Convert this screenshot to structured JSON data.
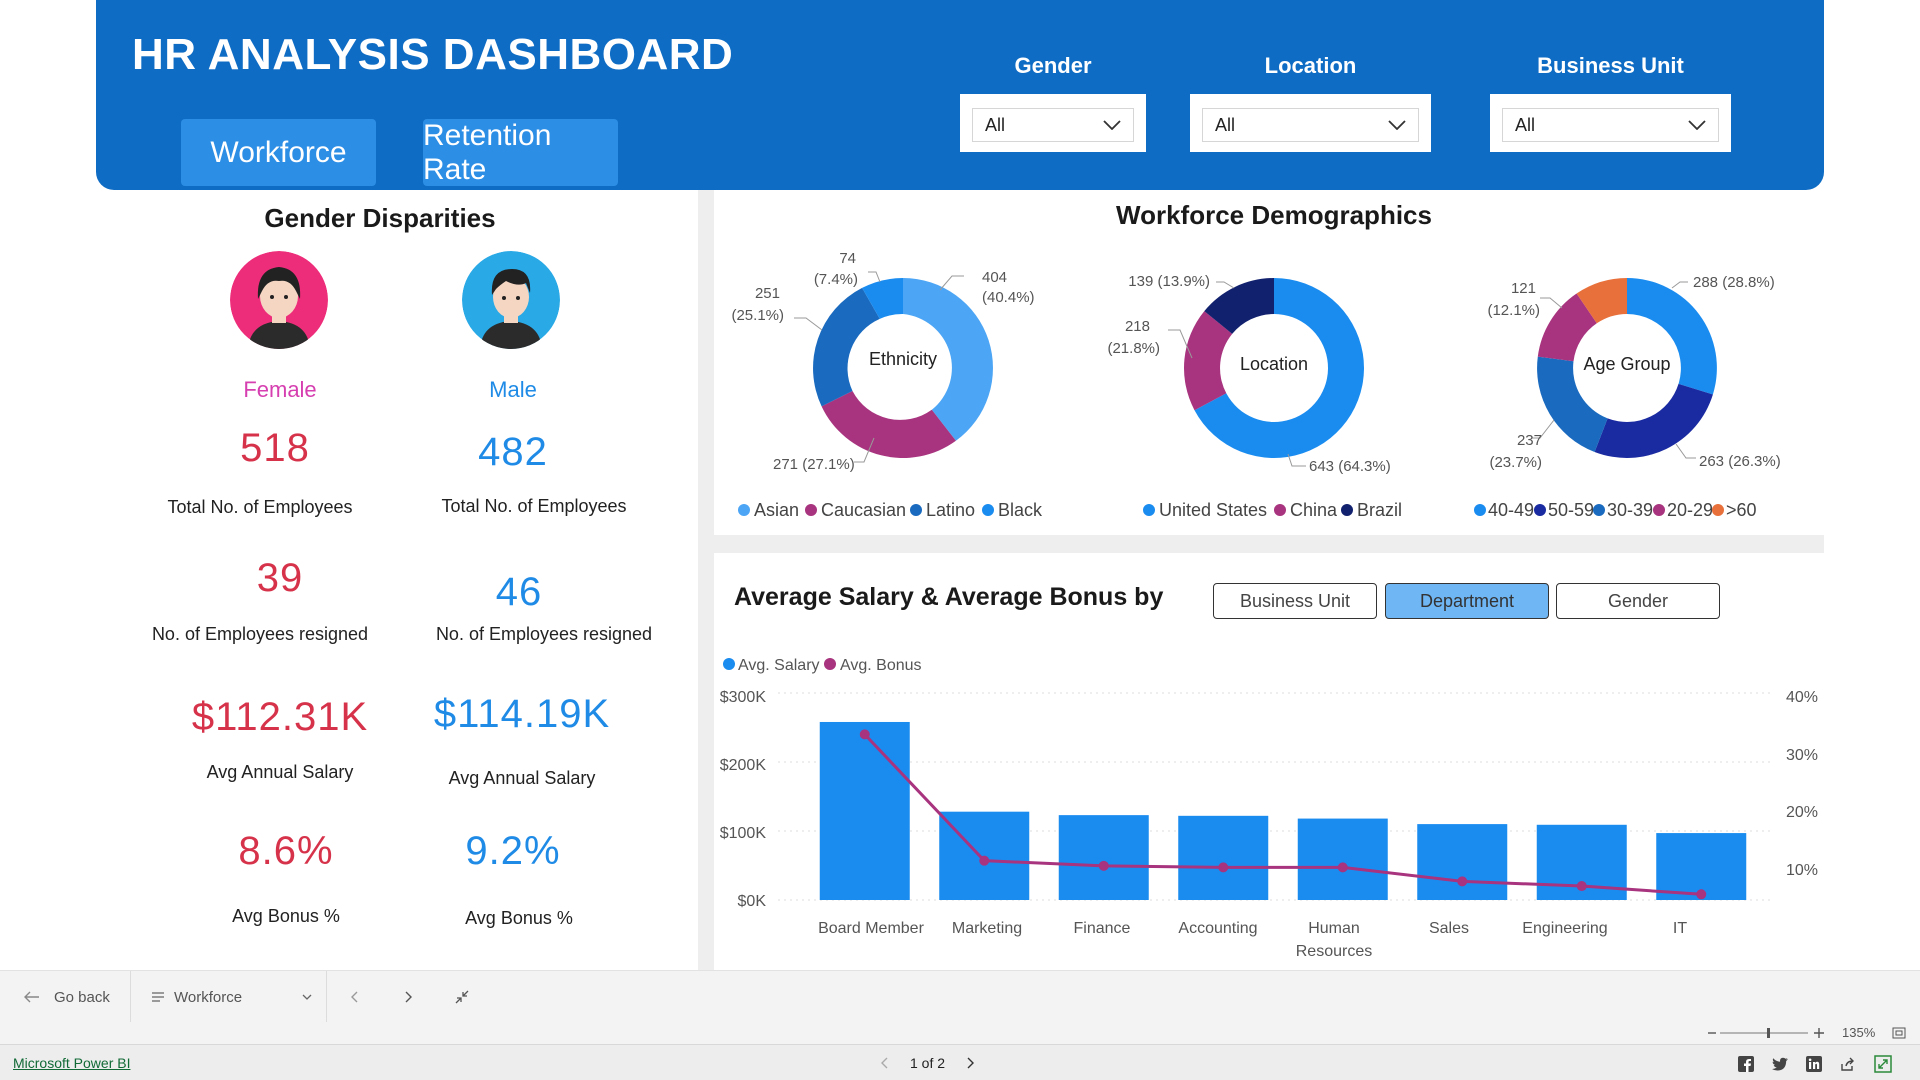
{
  "header": {
    "title": "HR ANALYSIS DASHBOARD",
    "nav": [
      "Workforce",
      "Retention Rate"
    ],
    "filters": [
      {
        "label": "Gender",
        "value": "All"
      },
      {
        "label": "Location",
        "value": "All"
      },
      {
        "label": "Business Unit",
        "value": "All"
      }
    ]
  },
  "gender": {
    "title": "Gender Disparities",
    "female": {
      "label": "Female",
      "total": "518",
      "total_label": "Total No. of Employees",
      "resigned": "39",
      "resigned_label": "No. of Employees resigned",
      "salary": "$112.31K",
      "salary_label": "Avg Annual Salary",
      "bonus": "8.6%",
      "bonus_label": "Avg Bonus %"
    },
    "male": {
      "label": "Male",
      "total": "482",
      "total_label": "Total No. of Employees",
      "resigned": "46",
      "resigned_label": "No. of Employees resigned",
      "salary": "$114.19K",
      "salary_label": "Avg Annual Salary",
      "bonus": "9.2%",
      "bonus_label": "Avg Bonus %"
    }
  },
  "demographics": {
    "title": "Workforce Demographics",
    "colors": {
      "asian": "#4da6f5",
      "caucasian": "#a8337e",
      "latino": "#1a6bc0",
      "black": "#1a8cf0",
      "us": "#1a8cf0",
      "china": "#a8337e",
      "brazil": "#12216e",
      "g4049": "#1a8cf0",
      "g5059": "#1a2aa0",
      "g3039": "#1a6bc0",
      "g2029": "#a8337e",
      "g60": "#e8703a"
    },
    "ethnicity": {
      "center": "Ethnicity",
      "labels": {
        "asian": "404",
        "asian_pct": "(40.4%)",
        "caucasian": "271 (27.1%)",
        "latino": "251",
        "latino_pct": "(25.1%)",
        "black": "74",
        "black_pct": "(7.4%)"
      },
      "legend": [
        "Asian",
        "Caucasian",
        "Latino",
        "Black"
      ]
    },
    "location": {
      "center": "Location",
      "labels": {
        "us": "643 (64.3%)",
        "china": "218",
        "china_pct": "(21.8%)",
        "brazil": "139 (13.9%)"
      },
      "legend": [
        "United States",
        "China",
        "Brazil"
      ]
    },
    "age": {
      "center": "Age Group",
      "labels": {
        "g4049": "288 (28.8%)",
        "g5059": "263 (26.3%)",
        "g3039": "237",
        "g3039_pct": "(23.7%)",
        "g2029": "121",
        "g2029_pct": "(12.1%)"
      },
      "legend": [
        "40-49",
        "50-59",
        "30-39",
        "20-29",
        ">60"
      ]
    }
  },
  "salary_chart": {
    "title": "Average Salary & Average Bonus by",
    "toggles": [
      "Business Unit",
      "Department",
      "Gender"
    ],
    "legend": [
      "Avg. Salary",
      "Avg. Bonus"
    ],
    "y_ticks": [
      "$300K",
      "$200K",
      "$100K",
      "$0K"
    ],
    "y2_ticks": [
      "40%",
      "30%",
      "20%",
      "10%"
    ],
    "x_labels": [
      "Board Member",
      "Marketing",
      "Finance",
      "Accounting",
      "Human",
      "Sales",
      "Engineering",
      "IT"
    ],
    "x_label_extra": "Resources"
  },
  "chart_data": {
    "type": "bar",
    "title": "Average Salary & Average Bonus by",
    "categories": [
      "Board Member",
      "Marketing",
      "Finance",
      "Accounting",
      "Human Resources",
      "Sales",
      "Engineering",
      "IT"
    ],
    "series": [
      {
        "name": "Avg. Salary",
        "type": "bar",
        "axis": "left",
        "values": [
          258000,
          128000,
          123000,
          122000,
          118000,
          110000,
          109000,
          97000
        ]
      },
      {
        "name": "Avg. Bonus",
        "type": "line",
        "axis": "right",
        "values": [
          0.32,
          0.076,
          0.066,
          0.063,
          0.063,
          0.036,
          0.027,
          0.011
        ]
      }
    ],
    "ylim": [
      0,
      300000
    ],
    "y2lim": [
      0,
      0.4
    ],
    "colors": {
      "bar": "#1a8cf0",
      "line": "#a8337e"
    }
  },
  "bottom_bar": {
    "go_back": "Go back",
    "page_select": "Workforce"
  },
  "zoom": {
    "value": "135%"
  },
  "footer": {
    "link": "Microsoft Power BI",
    "pager": "1 of 2"
  }
}
